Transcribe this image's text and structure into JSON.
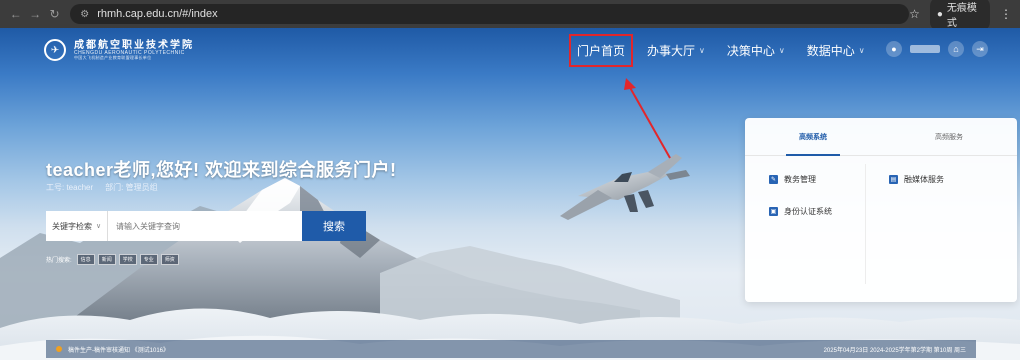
{
  "browser": {
    "url": "rhmh.cap.edu.cn/#/index",
    "incognito_label": "无痕模式"
  },
  "site": {
    "logo_cn": "成都航空职业技术学院",
    "logo_en": "CHENGDU AERONAUTIC POLYTECHNIC",
    "logo_sub": "中国大飞机制造产业教育联盟理事长单位"
  },
  "nav": {
    "home": "门户首页",
    "service_hall": "办事大厅",
    "decision_center": "决策中心",
    "data_center": "数据中心"
  },
  "greeting": {
    "title": "teacher老师,您好! 欢迎来到综合服务门户!",
    "work_id": "工号: teacher",
    "department": "部门: 管理员组"
  },
  "search": {
    "type_label": "关键字检索",
    "placeholder": "请输入关键字查询",
    "button": "搜索"
  },
  "tags": {
    "label": "热门搜索:",
    "items": [
      "信息",
      "新闻",
      "学校",
      "专业",
      "师资"
    ]
  },
  "panel": {
    "tabs": [
      "高频系统",
      "高频服务"
    ],
    "systems": [
      "教务管理",
      "融媒体服务",
      "身份认证系统"
    ]
  },
  "notice": {
    "text": "稿件生产-稿件审核通知 《测试1016》",
    "date": "2025年04月23日 2024-2025学年第2学期 第10周 周三"
  }
}
